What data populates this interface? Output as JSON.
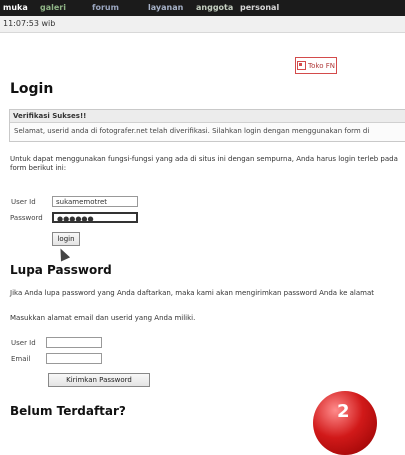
{
  "nav": {
    "items": [
      {
        "label": "muka"
      },
      {
        "label": "galeri"
      },
      {
        "label": "forum"
      },
      {
        "label": "layanan"
      },
      {
        "label": "anggota"
      },
      {
        "label": "personal"
      }
    ]
  },
  "clock": "11:07:53 wib",
  "toko": {
    "label": "Toko FN"
  },
  "page": {
    "title": "Login"
  },
  "notice": {
    "title": "Verifikasi Sukses!!",
    "message": "Selamat, userid anda di fotografer.net telah diverifikasi. Silahkan login dengan menggunakan form di"
  },
  "intro": {
    "text": "Untuk dapat menggunakan fungsi-fungsi yang ada di situs ini dengan sempurna, Anda harus login terleb pada form berikut ini:"
  },
  "login": {
    "userid_label": "User Id",
    "userid_value": "sukamemotret",
    "password_label": "Password",
    "password_value": "●●●●●●",
    "button_label": "login"
  },
  "lupa": {
    "title": "Lupa Password",
    "text1": "Jika Anda lupa password yang Anda daftarkan, maka kami akan mengirimkan password Anda ke alamat",
    "text2": "Masukkan alamat email dan userid yang Anda miliki.",
    "userid_label": "User Id",
    "email_label": "Email",
    "button_label": "Kirimkan Password"
  },
  "belum": {
    "title": "Belum Terdaftar?"
  },
  "colors": {
    "nav_bg": "#1b1b1b",
    "toko_border": "#d34b4b",
    "badge": "#d11919"
  },
  "icons": {
    "toko": "shop-icon",
    "cursor": "hand-cursor-icon"
  }
}
